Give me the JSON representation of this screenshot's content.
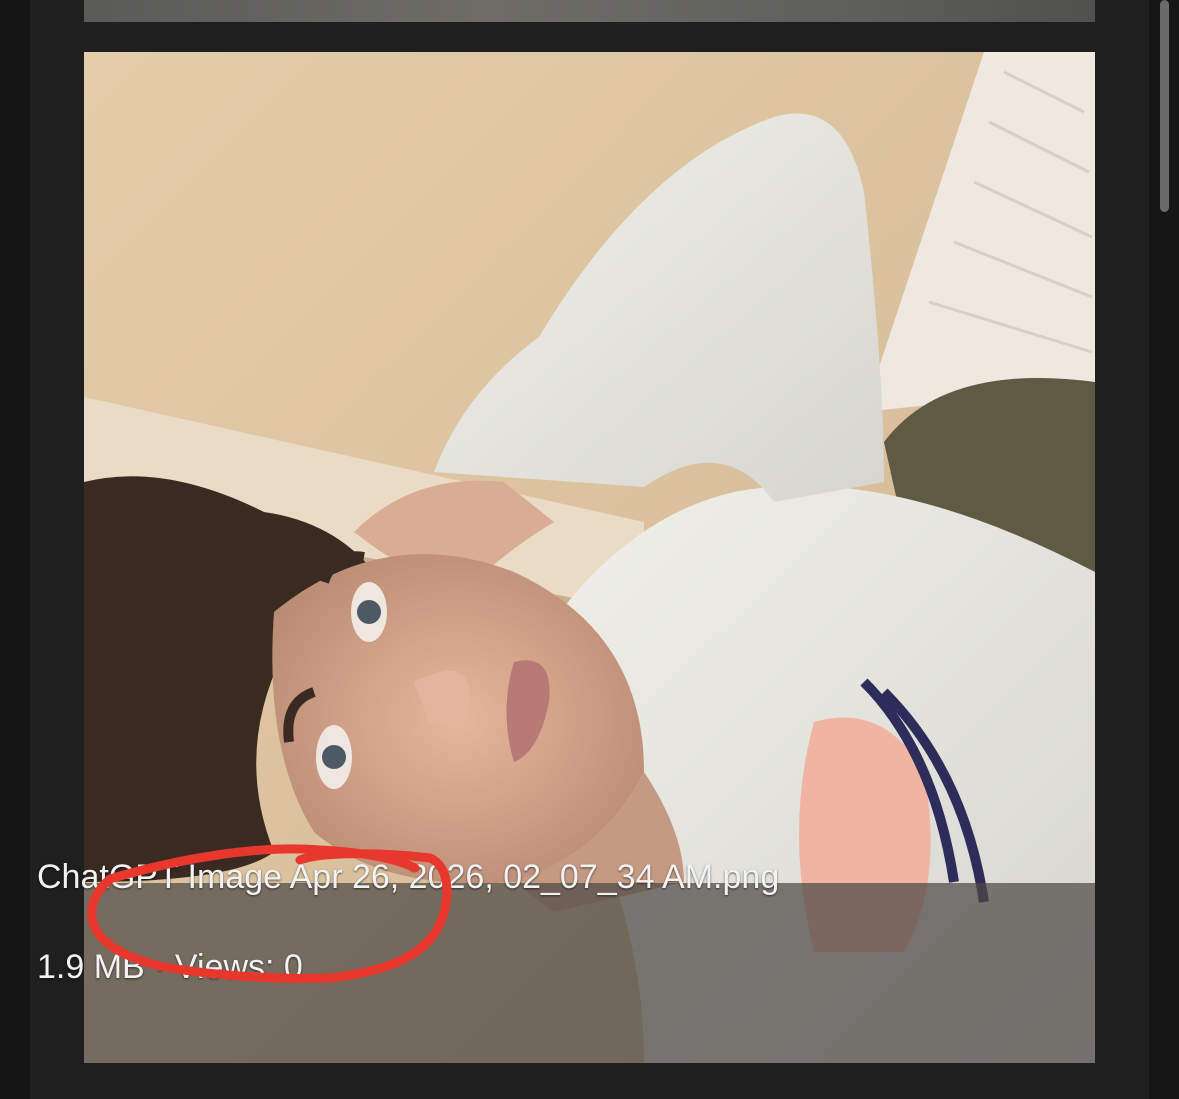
{
  "gallery": {
    "item": {
      "file_name": "ChatGPT Image Apr 26, 2026, 02_07_34 AM.png",
      "meta": "1.9 MB · Views: 0",
      "image_description": "photo-selfie"
    }
  },
  "annotation": {
    "color": "#e8382e",
    "shape": "hand-drawn-circle"
  },
  "colors": {
    "background": "#141414",
    "panel": "#1f1f1f",
    "caption_overlay": "#4e4a46",
    "text": "#f2f2f2"
  }
}
